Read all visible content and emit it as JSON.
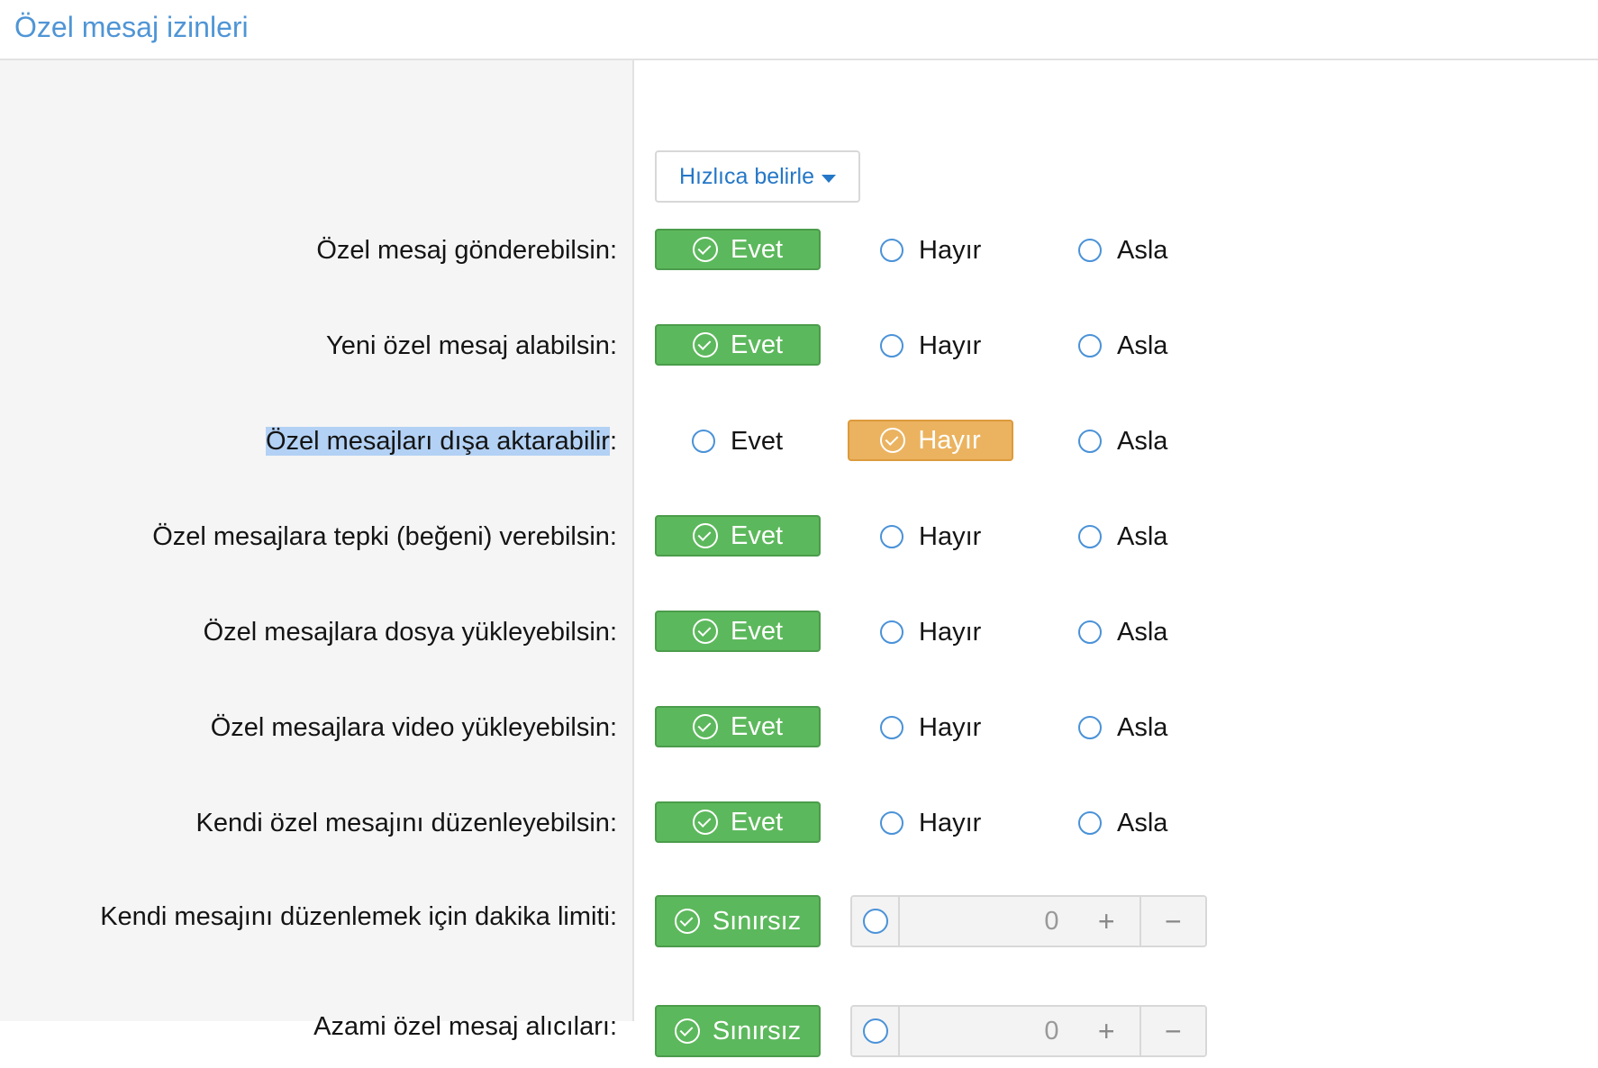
{
  "header": {
    "title": "Özel mesaj izinleri"
  },
  "quick": {
    "label": "Hızlıca belirle"
  },
  "options": {
    "yes": "Evet",
    "no": "Hayır",
    "never": "Asla",
    "unlimited": "Sınırsız"
  },
  "rows": [
    {
      "label": "Özel mesaj gönderebilsin:",
      "selected": "yes"
    },
    {
      "label": "Yeni özel mesaj alabilsin:",
      "selected": "yes"
    },
    {
      "label_highlighted": "Özel mesajları dışa aktarabilir",
      "label_suffix": ":",
      "selected": "no"
    },
    {
      "label": "Özel mesajlara tepki (beğeni) verebilsin:",
      "selected": "yes"
    },
    {
      "label": "Özel mesajlara dosya yükleyebilsin:",
      "selected": "yes"
    },
    {
      "label": "Özel mesajlara video yükleyebilsin:",
      "selected": "yes"
    },
    {
      "label": "Kendi özel mesajını düzenleyebilsin:",
      "selected": "yes"
    }
  ],
  "numeric_rows": [
    {
      "label": "Kendi mesajını düzenlemek için dakika limiti:",
      "value": "0",
      "selected": "unlimited"
    },
    {
      "label": "Azami özel mesaj alıcıları:",
      "value": "0",
      "selected": "unlimited"
    }
  ],
  "colors": {
    "yes_active": "#5cb85c",
    "no_active": "#ebb360",
    "radio": "#4a92d8",
    "title": "#4f95d6"
  }
}
